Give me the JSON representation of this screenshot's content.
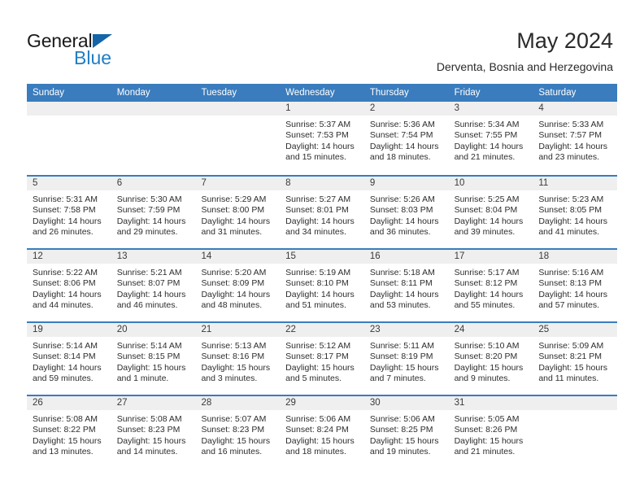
{
  "brand": {
    "name_dark": "General",
    "name_blue": "Blue",
    "accent_blue": "#1f7ec4",
    "triangle_blue": "#1565a8"
  },
  "header": {
    "title": "May 2024",
    "subtitle": "Derventa, Bosnia and Herzegovina",
    "header_bg": "#3a7cbd",
    "day_band_bg": "#efefef"
  },
  "weekdays": [
    "Sunday",
    "Monday",
    "Tuesday",
    "Wednesday",
    "Thursday",
    "Friday",
    "Saturday"
  ],
  "weeks": [
    [
      {
        "day": "",
        "lines": []
      },
      {
        "day": "",
        "lines": []
      },
      {
        "day": "",
        "lines": []
      },
      {
        "day": "1",
        "lines": [
          "Sunrise: 5:37 AM",
          "Sunset: 7:53 PM",
          "Daylight: 14 hours",
          "and 15 minutes."
        ]
      },
      {
        "day": "2",
        "lines": [
          "Sunrise: 5:36 AM",
          "Sunset: 7:54 PM",
          "Daylight: 14 hours",
          "and 18 minutes."
        ]
      },
      {
        "day": "3",
        "lines": [
          "Sunrise: 5:34 AM",
          "Sunset: 7:55 PM",
          "Daylight: 14 hours",
          "and 21 minutes."
        ]
      },
      {
        "day": "4",
        "lines": [
          "Sunrise: 5:33 AM",
          "Sunset: 7:57 PM",
          "Daylight: 14 hours",
          "and 23 minutes."
        ]
      }
    ],
    [
      {
        "day": "5",
        "lines": [
          "Sunrise: 5:31 AM",
          "Sunset: 7:58 PM",
          "Daylight: 14 hours",
          "and 26 minutes."
        ]
      },
      {
        "day": "6",
        "lines": [
          "Sunrise: 5:30 AM",
          "Sunset: 7:59 PM",
          "Daylight: 14 hours",
          "and 29 minutes."
        ]
      },
      {
        "day": "7",
        "lines": [
          "Sunrise: 5:29 AM",
          "Sunset: 8:00 PM",
          "Daylight: 14 hours",
          "and 31 minutes."
        ]
      },
      {
        "day": "8",
        "lines": [
          "Sunrise: 5:27 AM",
          "Sunset: 8:01 PM",
          "Daylight: 14 hours",
          "and 34 minutes."
        ]
      },
      {
        "day": "9",
        "lines": [
          "Sunrise: 5:26 AM",
          "Sunset: 8:03 PM",
          "Daylight: 14 hours",
          "and 36 minutes."
        ]
      },
      {
        "day": "10",
        "lines": [
          "Sunrise: 5:25 AM",
          "Sunset: 8:04 PM",
          "Daylight: 14 hours",
          "and 39 minutes."
        ]
      },
      {
        "day": "11",
        "lines": [
          "Sunrise: 5:23 AM",
          "Sunset: 8:05 PM",
          "Daylight: 14 hours",
          "and 41 minutes."
        ]
      }
    ],
    [
      {
        "day": "12",
        "lines": [
          "Sunrise: 5:22 AM",
          "Sunset: 8:06 PM",
          "Daylight: 14 hours",
          "and 44 minutes."
        ]
      },
      {
        "day": "13",
        "lines": [
          "Sunrise: 5:21 AM",
          "Sunset: 8:07 PM",
          "Daylight: 14 hours",
          "and 46 minutes."
        ]
      },
      {
        "day": "14",
        "lines": [
          "Sunrise: 5:20 AM",
          "Sunset: 8:09 PM",
          "Daylight: 14 hours",
          "and 48 minutes."
        ]
      },
      {
        "day": "15",
        "lines": [
          "Sunrise: 5:19 AM",
          "Sunset: 8:10 PM",
          "Daylight: 14 hours",
          "and 51 minutes."
        ]
      },
      {
        "day": "16",
        "lines": [
          "Sunrise: 5:18 AM",
          "Sunset: 8:11 PM",
          "Daylight: 14 hours",
          "and 53 minutes."
        ]
      },
      {
        "day": "17",
        "lines": [
          "Sunrise: 5:17 AM",
          "Sunset: 8:12 PM",
          "Daylight: 14 hours",
          "and 55 minutes."
        ]
      },
      {
        "day": "18",
        "lines": [
          "Sunrise: 5:16 AM",
          "Sunset: 8:13 PM",
          "Daylight: 14 hours",
          "and 57 minutes."
        ]
      }
    ],
    [
      {
        "day": "19",
        "lines": [
          "Sunrise: 5:14 AM",
          "Sunset: 8:14 PM",
          "Daylight: 14 hours",
          "and 59 minutes."
        ]
      },
      {
        "day": "20",
        "lines": [
          "Sunrise: 5:14 AM",
          "Sunset: 8:15 PM",
          "Daylight: 15 hours",
          "and 1 minute."
        ]
      },
      {
        "day": "21",
        "lines": [
          "Sunrise: 5:13 AM",
          "Sunset: 8:16 PM",
          "Daylight: 15 hours",
          "and 3 minutes."
        ]
      },
      {
        "day": "22",
        "lines": [
          "Sunrise: 5:12 AM",
          "Sunset: 8:17 PM",
          "Daylight: 15 hours",
          "and 5 minutes."
        ]
      },
      {
        "day": "23",
        "lines": [
          "Sunrise: 5:11 AM",
          "Sunset: 8:19 PM",
          "Daylight: 15 hours",
          "and 7 minutes."
        ]
      },
      {
        "day": "24",
        "lines": [
          "Sunrise: 5:10 AM",
          "Sunset: 8:20 PM",
          "Daylight: 15 hours",
          "and 9 minutes."
        ]
      },
      {
        "day": "25",
        "lines": [
          "Sunrise: 5:09 AM",
          "Sunset: 8:21 PM",
          "Daylight: 15 hours",
          "and 11 minutes."
        ]
      }
    ],
    [
      {
        "day": "26",
        "lines": [
          "Sunrise: 5:08 AM",
          "Sunset: 8:22 PM",
          "Daylight: 15 hours",
          "and 13 minutes."
        ]
      },
      {
        "day": "27",
        "lines": [
          "Sunrise: 5:08 AM",
          "Sunset: 8:23 PM",
          "Daylight: 15 hours",
          "and 14 minutes."
        ]
      },
      {
        "day": "28",
        "lines": [
          "Sunrise: 5:07 AM",
          "Sunset: 8:23 PM",
          "Daylight: 15 hours",
          "and 16 minutes."
        ]
      },
      {
        "day": "29",
        "lines": [
          "Sunrise: 5:06 AM",
          "Sunset: 8:24 PM",
          "Daylight: 15 hours",
          "and 18 minutes."
        ]
      },
      {
        "day": "30",
        "lines": [
          "Sunrise: 5:06 AM",
          "Sunset: 8:25 PM",
          "Daylight: 15 hours",
          "and 19 minutes."
        ]
      },
      {
        "day": "31",
        "lines": [
          "Sunrise: 5:05 AM",
          "Sunset: 8:26 PM",
          "Daylight: 15 hours",
          "and 21 minutes."
        ]
      },
      {
        "day": "",
        "lines": []
      }
    ]
  ]
}
